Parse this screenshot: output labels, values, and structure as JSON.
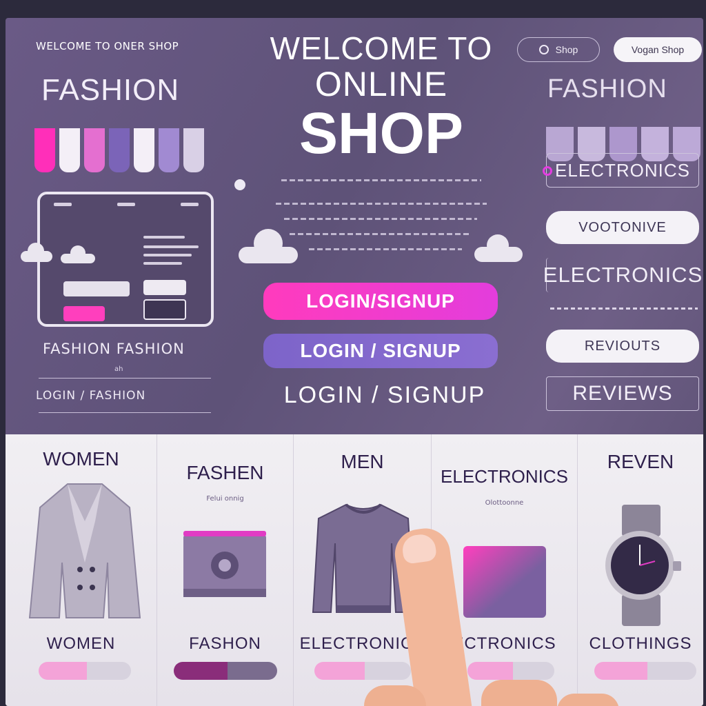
{
  "left": {
    "welcome_small": "WELCOME TO ONER SHOP",
    "fashion_title": "FASHION",
    "fashion_fashion": "FASHION  FASHION",
    "small_note": "ah",
    "login_fashion": "LOGIN  /  FASHION"
  },
  "hero": {
    "line1": "WELCOME TO",
    "line2": "ONLINE",
    "line3": "SHOP"
  },
  "center": {
    "login_primary": "LOGIN/SIGNUP",
    "login_secondary": "LOGIN / SIGNUP",
    "login_plain": "LOGIN / SIGNUP"
  },
  "right": {
    "pill_shop": "Shop",
    "pill_vogue": "Vogan Shop",
    "fashion_title": "FASHION",
    "nav_1": "ELECTRONICS",
    "nav_2": "VOOTONIVE",
    "nav_3": "ELECTRONICS",
    "nav_4": "REVIOUTS",
    "nav_5": "REVIEWS"
  },
  "categories": [
    {
      "title": "WOMEN",
      "bottom": "WOMEN"
    },
    {
      "title": "FASHEN",
      "sub": "Felui onnig",
      "bottom": "FASHON"
    },
    {
      "title": "MEN",
      "bottom": "ELECTRONICS"
    },
    {
      "title": "ELECTRONICS",
      "sub": "Olottoonne",
      "bottom": "ECTRONICS"
    },
    {
      "title": "REVEN",
      "bottom": "CLOTHINGS"
    }
  ],
  "colors": {
    "accent_pink": "#ff3bbd",
    "accent_purple": "#7d64c9",
    "deep_text": "#2e1f4c"
  }
}
